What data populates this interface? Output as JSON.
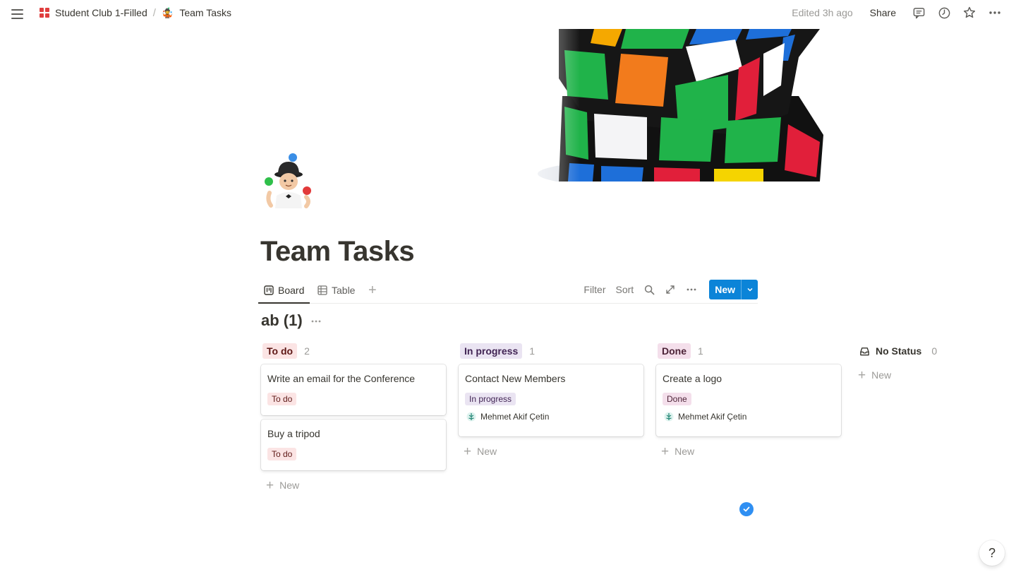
{
  "breadcrumb": {
    "workspace": "Student Club 1-Filled",
    "separator": "/",
    "page": "Team Tasks",
    "page_icon": "🤹"
  },
  "topbar": {
    "edited": "Edited 3h ago",
    "share": "Share",
    "icons": [
      "comments-icon",
      "history-icon",
      "favorite-star-icon",
      "more-icon"
    ]
  },
  "page": {
    "title": "Team Tasks",
    "icon_name": "juggler-emoji-icon",
    "cover_name": "rubiks-cube-cover"
  },
  "views": {
    "tabs": [
      {
        "label": "Board",
        "active": true
      },
      {
        "label": "Table",
        "active": false
      }
    ],
    "filter": "Filter",
    "sort": "Sort",
    "new": "New"
  },
  "group": {
    "title": "ab (1)"
  },
  "columns": [
    {
      "status": "To do",
      "count": "2",
      "cards": [
        {
          "title": "Write an email for the Conference",
          "tag": "To do"
        },
        {
          "title": "Buy a tripod",
          "tag": "To do"
        }
      ],
      "new_label": "New"
    },
    {
      "status": "In progress",
      "count": "1",
      "cards": [
        {
          "title": "Contact New Members",
          "tag": "In progress",
          "assignee": "Mehmet Akif Çetin"
        }
      ],
      "new_label": "New"
    },
    {
      "status": "Done",
      "count": "1",
      "cards": [
        {
          "title": "Create a logo",
          "tag": "Done",
          "assignee": "Mehmet Akif Çetin"
        }
      ],
      "new_label": "New"
    },
    {
      "status": "No Status",
      "count": "0",
      "cards": [],
      "new_label": "New"
    }
  ],
  "help": "?",
  "colors": {
    "accent": "#0b84d8",
    "todo_bg": "#fbe4e4",
    "progress_bg": "#eae4f2",
    "done_bg": "#f4dfeb"
  }
}
